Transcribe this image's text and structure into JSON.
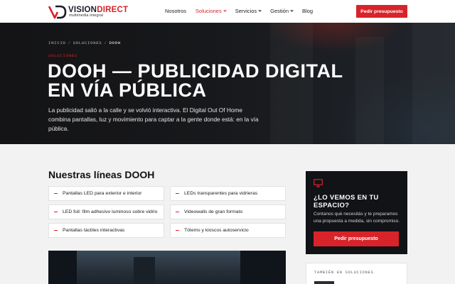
{
  "brand": {
    "name_part1": "VISION",
    "name_part2": "DIRECT",
    "tagline": "multimedia integral",
    "colors": {
      "accent": "#d8232a",
      "dark": "#121316"
    }
  },
  "nav": {
    "items": [
      {
        "label": "Nosotros"
      },
      {
        "label": "Soluciones"
      },
      {
        "label": "Servicios"
      },
      {
        "label": "Gestión"
      },
      {
        "label": "Blog"
      }
    ],
    "cta_label": "Pedir presupuesto"
  },
  "hero": {
    "breadcrumb": {
      "home": "INICIO",
      "section": "SOLUCIONES",
      "current": "DOOH",
      "sep": "/"
    },
    "eyebrow": "SOLUCIONES",
    "title": "DOOH — PUBLICIDAD DIGITAL EN VÍA PÚBLICA",
    "description": "La publicidad salió a la calle y se volvió interactiva. El Digital Out Of Home combina pantallas, luz y movimiento para captar a la gente donde está: en la vía pública."
  },
  "main": {
    "section_title": "Nuestras líneas DOOH",
    "lines": [
      "Pantallas LED para exterior e interior",
      "LEDs transparentes para vidrieras",
      "LED foil: film adhesivo luminoso sobre vidrio",
      "Videowalls de gran formato",
      "Pantallas táctiles interactivas",
      "Tótems y kioscos autoservicio"
    ]
  },
  "sidebar": {
    "icon": "monitor-icon",
    "title": "¿LO VEMOS EN TU ESPACIO?",
    "text": "Contanos qué necesitás y te preparamos una propuesta a medida, sin compromiso.",
    "button_label": "Pedir presupuesto",
    "also_label": "TAMBIÉN EN SOLUCIONES"
  }
}
